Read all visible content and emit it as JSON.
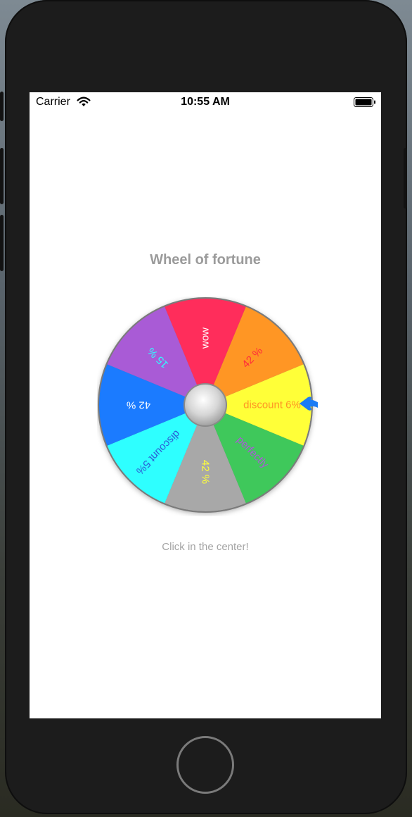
{
  "status_bar": {
    "carrier": "Carrier",
    "time": "10:55 AM",
    "icons": [
      "wifi-icon",
      "battery-icon"
    ]
  },
  "title": "Wheel of fortune",
  "wheel": {
    "segments": [
      {
        "label": "discount 6%",
        "color": "#ffff38",
        "text_color": "#ff9624"
      },
      {
        "label": "perfectly",
        "color": "#3fc85b",
        "text_color": "#a95bd6"
      },
      {
        "label": "42 %",
        "color": "#a8a8a8",
        "text_color": "#ffff38"
      },
      {
        "label": "discount 5%",
        "color": "#2effff",
        "text_color": "#2d5bd6"
      },
      {
        "label": "42 %",
        "color": "#1b7bff",
        "text_color": "#ffffff"
      },
      {
        "label": "15 %",
        "color": "#a95bd6",
        "text_color": "#2effff"
      },
      {
        "label": "wow",
        "color": "#ff2d5b",
        "text_color": "#ffffff"
      },
      {
        "label": "42 %",
        "color": "#ff9624",
        "text_color": "#ff2d3b"
      }
    ],
    "pointer_color": "#1c7cf5",
    "hub_icon": "spin-button-icon"
  },
  "hint": "Click in the center!"
}
